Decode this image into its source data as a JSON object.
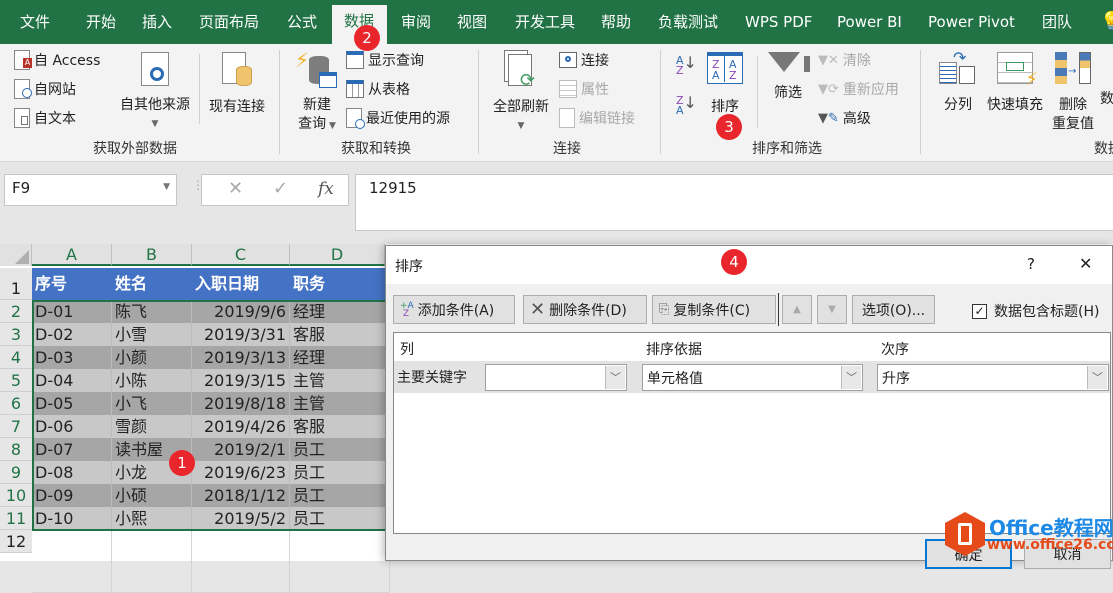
{
  "tabs": [
    {
      "label": "文件",
      "active": false
    },
    {
      "label": "开始",
      "active": false
    },
    {
      "label": "插入",
      "active": false
    },
    {
      "label": "页面布局",
      "active": false
    },
    {
      "label": "公式",
      "active": false
    },
    {
      "label": "数据",
      "active": true
    },
    {
      "label": "审阅",
      "active": false
    },
    {
      "label": "视图",
      "active": false
    },
    {
      "label": "开发工具",
      "active": false
    },
    {
      "label": "帮助",
      "active": false
    },
    {
      "label": "负载测试",
      "active": false
    },
    {
      "label": "WPS PDF",
      "active": false
    },
    {
      "label": "Power BI",
      "active": false
    },
    {
      "label": "Power Pivot",
      "active": false
    },
    {
      "label": "团队",
      "active": false
    }
  ],
  "ribbon": {
    "get_external": {
      "group_label": "获取外部数据",
      "from_access": "自 Access",
      "from_web": "自网站",
      "from_text": "自文本",
      "from_other": "自其他来源",
      "existing_conn": "现有连接"
    },
    "get_transform": {
      "group_label": "获取和转换",
      "new_query_1": "新建",
      "new_query_2": "查询",
      "show_queries": "显示查询",
      "from_table": "从表格",
      "recent_sources": "最近使用的源"
    },
    "connections": {
      "group_label": "连接",
      "refresh_all": "全部刷新",
      "connections": "连接",
      "properties": "属性",
      "edit_links": "编辑链接"
    },
    "sort_filter": {
      "group_label": "排序和筛选",
      "sort": "排序",
      "filter": "筛选",
      "clear": "清除",
      "reapply": "重新应用",
      "advanced": "高级"
    },
    "data_tools": {
      "group_label": "数据",
      "text_to_columns": "分列",
      "flash_fill": "快速填充",
      "remove_dup_1": "删除",
      "remove_dup_2": "重复值",
      "partial": "数"
    }
  },
  "formula_bar": {
    "name_box": "F9",
    "value": "12915",
    "fx_label": "fx"
  },
  "sheet": {
    "columns": [
      "A",
      "B",
      "C",
      "D"
    ],
    "header_row": [
      "序号",
      "姓名",
      "入职日期",
      "职务"
    ],
    "rows": [
      [
        "D-01",
        "陈飞",
        "2019/9/6",
        "经理"
      ],
      [
        "D-02",
        "小雪",
        "2019/3/31",
        "客服"
      ],
      [
        "D-03",
        "小颜",
        "2019/3/13",
        "经理"
      ],
      [
        "D-04",
        "小陈",
        "2019/3/15",
        "主管"
      ],
      [
        "D-05",
        "小飞",
        "2019/8/18",
        "主管"
      ],
      [
        "D-06",
        "雪颜",
        "2019/4/26",
        "客服"
      ],
      [
        "D-07",
        "读书屋",
        "2019/2/1",
        "员工"
      ],
      [
        "D-08",
        "小龙",
        "2019/6/23",
        "员工"
      ],
      [
        "D-09",
        "小硕",
        "2018/1/12",
        "员工"
      ],
      [
        "D-10",
        "小熙",
        "2019/5/2",
        "员工"
      ]
    ],
    "row_numbers": [
      "1",
      "2",
      "3",
      "4",
      "5",
      "6",
      "7",
      "8",
      "9",
      "10",
      "11",
      "12"
    ]
  },
  "dialog": {
    "title": "排序",
    "help": "?",
    "close": "✕",
    "add_level": "添加条件(A)",
    "delete_level": "删除条件(D)",
    "copy_level": "复制条件(C)",
    "options": "选项(O)...",
    "has_headers_label": "数据包含标题(H)",
    "has_headers_checked": true,
    "col_header": "列",
    "sort_on_header": "排序依据",
    "order_header": "次序",
    "primary_key_label": "主要关键字",
    "column_value": "",
    "sort_on_value": "单元格值",
    "order_value": "升序",
    "ok": "确定",
    "cancel": "取消"
  },
  "badges": [
    "1",
    "2",
    "3",
    "4"
  ],
  "watermark": {
    "title": "Office教程网",
    "url": "www.office26.com"
  },
  "colors": {
    "excel_green": "#217346",
    "header_blue": "#4472c4",
    "badge_red": "#e8262b",
    "row_dark": "#a6a6a6",
    "row_light": "#c8c8c8"
  }
}
